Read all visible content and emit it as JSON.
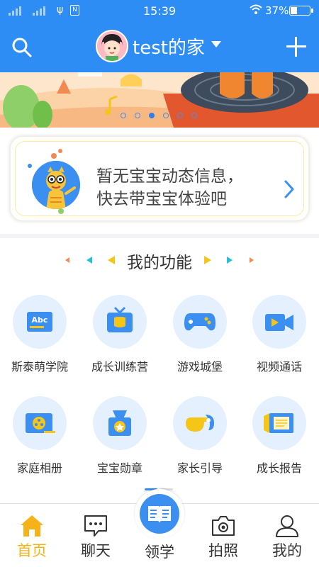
{
  "status_bar": {
    "time": "15:39",
    "battery_percent": "37%",
    "battery_level": 0.37
  },
  "header": {
    "title": "test的家",
    "search_icon": "search-icon",
    "add_icon": "plus-icon"
  },
  "banner": {
    "page_count": 6,
    "active_index": 2
  },
  "baby_card": {
    "line1": "暂无宝宝动态信息，",
    "line2": "快去带宝宝体验吧"
  },
  "functions": {
    "title": "我的功能",
    "items": [
      {
        "label": "斯泰萌学院",
        "icon": "abc-board-icon"
      },
      {
        "label": "成长训练营",
        "icon": "tv-icon"
      },
      {
        "label": "游戏城堡",
        "icon": "gamepad-icon"
      },
      {
        "label": "视频通话",
        "icon": "video-camera-icon"
      },
      {
        "label": "家庭相册",
        "icon": "film-reel-icon"
      },
      {
        "label": "宝宝勋章",
        "icon": "medal-icon"
      },
      {
        "label": "家长引导",
        "icon": "whistle-icon"
      },
      {
        "label": "成长报告",
        "icon": "report-scroll-icon"
      }
    ]
  },
  "tabbar": {
    "items": [
      {
        "label": "首页",
        "active": true
      },
      {
        "label": "聊天",
        "active": false
      },
      {
        "label": "领学",
        "active": false
      },
      {
        "label": "拍照",
        "active": false
      },
      {
        "label": "我的",
        "active": false
      }
    ]
  },
  "colors": {
    "header_blue": "#2e8df5",
    "active_tab": "#f5b319",
    "icon_circle": "#e4f0fd"
  }
}
